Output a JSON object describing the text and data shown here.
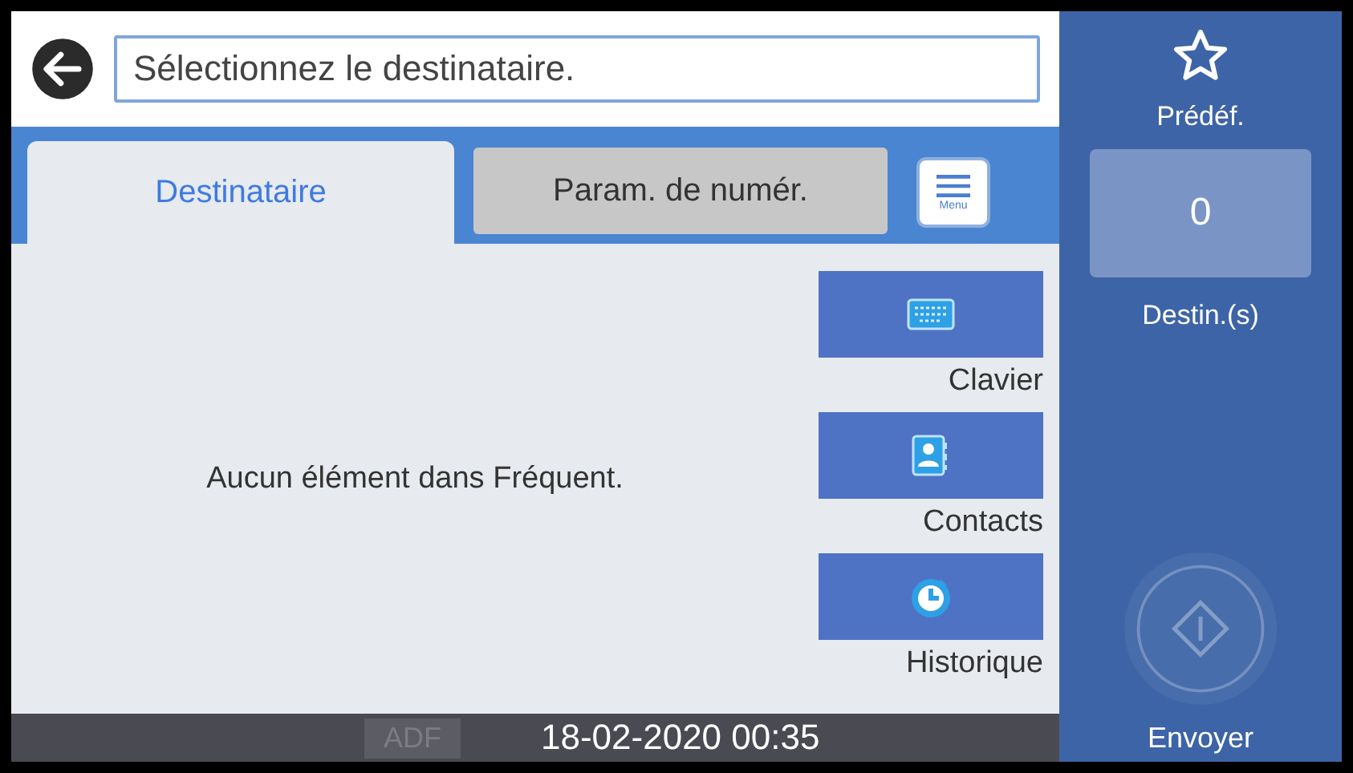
{
  "header": {
    "placeholder": "Sélectionnez le destinataire."
  },
  "tabs": [
    {
      "label": "Destinataire",
      "selected": true
    },
    {
      "label": "Param. de numér.",
      "selected": false
    }
  ],
  "menu_button": {
    "label": "Menu"
  },
  "message": "Aucun élément dans Fréquent.",
  "actions": [
    {
      "kind": "keyboard",
      "label": "Clavier"
    },
    {
      "kind": "contacts",
      "label": "Contacts"
    },
    {
      "kind": "history",
      "label": "Historique"
    }
  ],
  "status_bar": {
    "source": "ADF",
    "source_disabled": true,
    "datetime": "18-02-2020 00:35"
  },
  "side": {
    "presets": "Prédéf.",
    "count": "0",
    "count_label": "Destin.(s)",
    "send_label": "Envoyer",
    "send_disabled": true
  }
}
